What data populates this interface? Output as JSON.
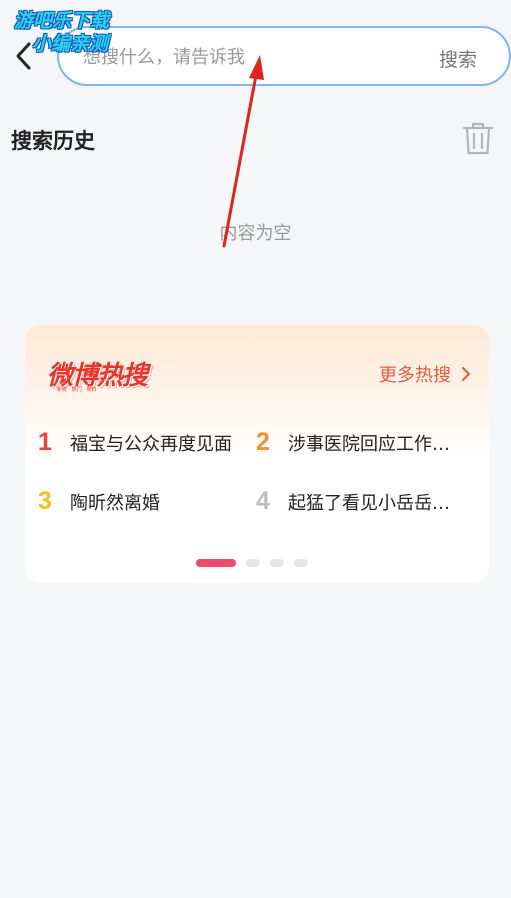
{
  "watermark": {
    "line1": "游吧乐下载",
    "line2": "小编亲测"
  },
  "search": {
    "placeholder": "想搜什么，请告诉我",
    "button_label": "搜索"
  },
  "history": {
    "title": "搜索历史",
    "empty_text": "内容为空"
  },
  "hot": {
    "logo_text": "微博热搜",
    "logo_sub": "新鲜 · 热门 · 有料",
    "more_label": "更多热搜",
    "items": [
      {
        "rank": "1",
        "title": "福宝与公众再度见面",
        "color": "#f0423b"
      },
      {
        "rank": "2",
        "title": "涉事医院回应工作…",
        "color": "#f7902d"
      },
      {
        "rank": "3",
        "title": "陶昕然离婚",
        "color": "#f6c021"
      },
      {
        "rank": "4",
        "title": "起猛了看见小岳岳…",
        "color": "#bdbdbd"
      }
    ],
    "page_count": "4",
    "active_page": "1"
  },
  "colors": {
    "accent_border": "#7fb3f6",
    "hot_red": "#e85a3c",
    "dot_active": "#f2486b"
  }
}
